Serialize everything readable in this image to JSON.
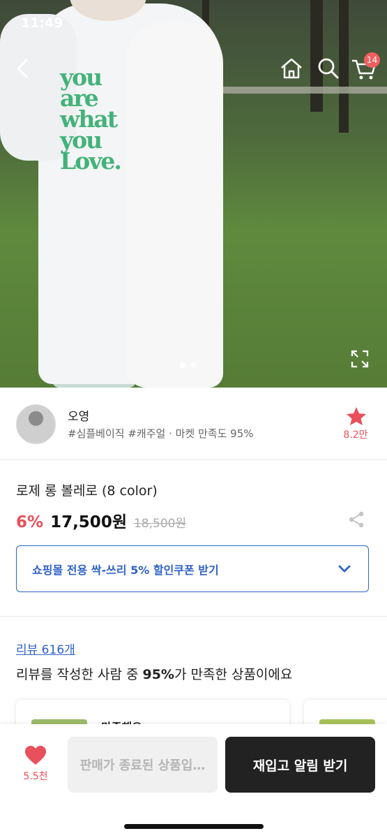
{
  "status_bar": {
    "time": "11:49"
  },
  "header": {
    "back_icon": "chevron-left-icon",
    "home_icon": "home-icon",
    "search_icon": "search-icon",
    "cart_icon": "cart-icon",
    "cart_badge": "14"
  },
  "hero": {
    "print_lines": [
      "you",
      "are",
      "what",
      "you",
      "Love."
    ],
    "expand_icon": "expand-icon",
    "slide_count": 2,
    "active_slide": 1
  },
  "seller": {
    "name": "오영",
    "tags": "#심플베이직 #캐주얼 · 마켓 만족도 95%",
    "favorite_count": "8.2만"
  },
  "product": {
    "title": "로제 롱 볼레로 (8 color)",
    "discount": "6%",
    "price": "17,500원",
    "original_price": "18,500원"
  },
  "coupon": {
    "label": "쇼핑몰 전용 싹-쓰리 5% 할인쿠폰 받기"
  },
  "reviews": {
    "link_label": "리뷰 616개",
    "summary_prefix": "리뷰를 작성한 사람 중 ",
    "summary_highlight": "95%",
    "summary_suffix": "가 만족한 상품이에요",
    "cards": [
      {
        "text": "만족해요"
      },
      {
        "text": ""
      }
    ]
  },
  "bottom_bar": {
    "like_count": "5.5천",
    "soldout_label": "판매가 종료된 상품입…",
    "restock_label": "재입고 알림 받기"
  },
  "colors": {
    "accent_blue": "#2f62c7",
    "accent_red": "#e8505b",
    "print_green": "#43b27a",
    "dark_button": "#222222"
  }
}
